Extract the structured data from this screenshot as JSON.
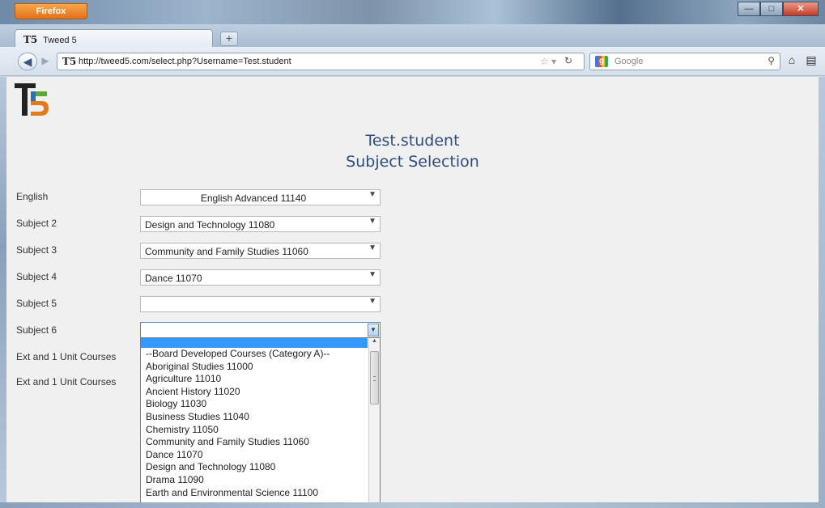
{
  "browser": {
    "menu_button_label": "Firefox",
    "tab_title": "Tweed 5",
    "tab_favicon": "T5",
    "new_tab_label": "+",
    "url": "http://tweed5.com/select.php?Username=Test.student",
    "search_engine": "Google",
    "icons": [
      "back-arrow-icon",
      "forward-arrow-icon",
      "bookmark-star-icon",
      "reload-icon",
      "google-logo-icon",
      "magnifier-icon",
      "home-icon",
      "menu-icon"
    ]
  },
  "page": {
    "student_name": "Test.student",
    "title": "Subject Selection",
    "logo": "T5",
    "colors": {
      "heading": "#2f4d7a",
      "highlight": "#3399ff",
      "logo_green": "#58a83c",
      "logo_orange": "#e27a1b",
      "logo_blue": "#2f6fb0"
    }
  },
  "form": {
    "fields": [
      {
        "label": "English",
        "value": "English Advanced 11140"
      },
      {
        "label": "Subject 2",
        "value": "Design and Technology 11080"
      },
      {
        "label": "Subject 3",
        "value": "Community and Family Studies 11060"
      },
      {
        "label": "Subject 4",
        "value": "Dance 11070"
      },
      {
        "label": "Subject 5",
        "value": ""
      },
      {
        "label": "Subject 6",
        "value": ""
      },
      {
        "label": "Ext and 1 Unit Courses",
        "value": ""
      },
      {
        "label": "Ext and 1 Unit Courses",
        "value": ""
      }
    ],
    "dropdown_options": [
      "--Board Developed Courses (Category A)--",
      "Aboriginal Studies 11000",
      "Agriculture 11010",
      "Ancient History 11020",
      "Biology 11030",
      "Business Studies 11040",
      "Chemistry 11050",
      "Community and Family Studies 11060",
      "Dance 11070",
      "Design and Technology 11080",
      "Drama 11090",
      "Earth and Environmental Science 11100"
    ]
  }
}
